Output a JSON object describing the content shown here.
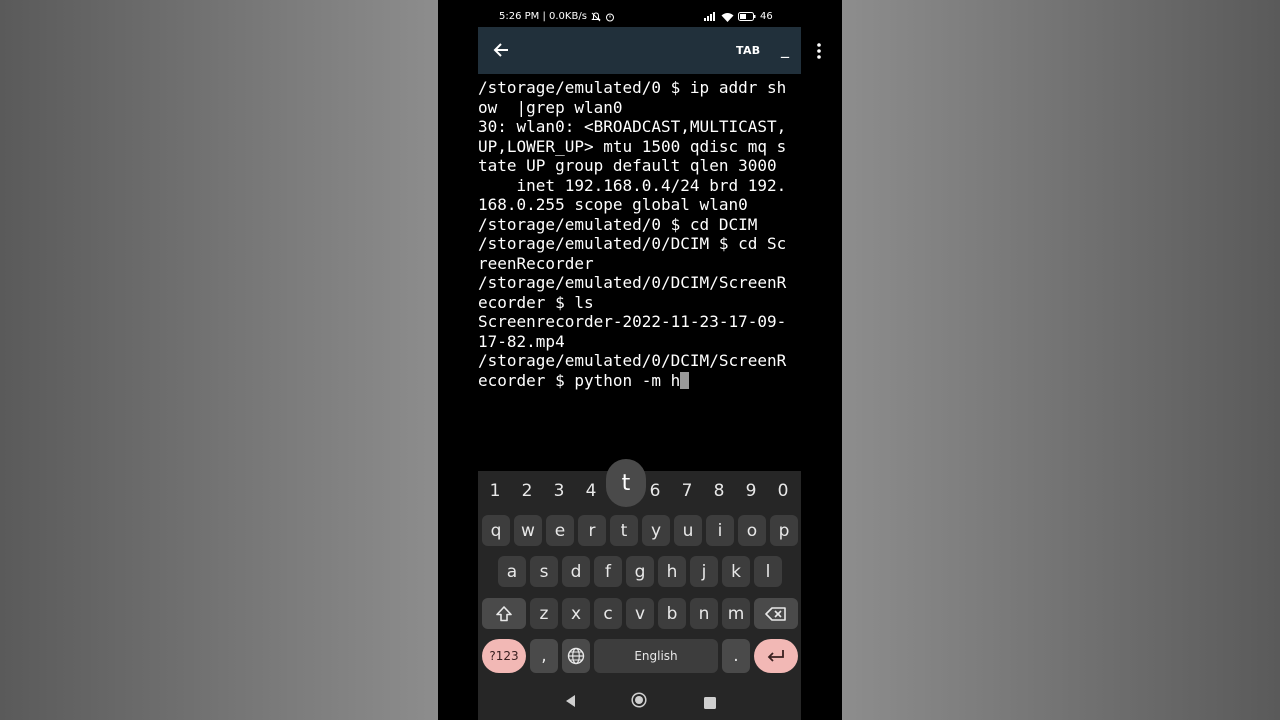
{
  "status_bar": {
    "left_text": "5:26 PM | 0.0KB/s",
    "battery_text": "46"
  },
  "app_bar": {
    "tab_label": "TAB",
    "underscore_label": "_"
  },
  "terminal": {
    "lines": [
      "/storage/emulated/0 $ ip addr sh",
      "ow  |grep wlan0",
      "30: wlan0: <BROADCAST,MULTICAST,",
      "UP,LOWER_UP> mtu 1500 qdisc mq s",
      "tate UP group default qlen 3000",
      "    inet 192.168.0.4/24 brd 192.",
      "168.0.255 scope global wlan0",
      "/storage/emulated/0 $ cd DCIM",
      "/storage/emulated/0/DCIM $ cd Sc",
      "reenRecorder",
      "/storage/emulated/0/DCIM/ScreenR",
      "ecorder $ ls",
      "Screenrecorder-2022-11-23-17-09-",
      "17-82.mp4",
      "/storage/emulated/0/DCIM/ScreenR",
      "ecorder $ python -m h"
    ]
  },
  "keyboard": {
    "number_row": [
      "1",
      "2",
      "3",
      "4",
      "6",
      "7",
      "8",
      "9",
      "0"
    ],
    "popup_key": "t",
    "row1": [
      "q",
      "w",
      "e",
      "r",
      "t",
      "y",
      "u",
      "i",
      "o",
      "p"
    ],
    "row2": [
      "a",
      "s",
      "d",
      "f",
      "g",
      "h",
      "j",
      "k",
      "l"
    ],
    "row3": [
      "z",
      "x",
      "c",
      "v",
      "b",
      "n",
      "m"
    ],
    "symbols_label": "?123",
    "comma_label": ",",
    "space_label": "English",
    "period_label": "."
  },
  "colors": {
    "app_bar": "#21303b",
    "keyboard_bg": "#262626",
    "key": "#3d3d3d",
    "accent_pink": "#f2b8b5"
  }
}
